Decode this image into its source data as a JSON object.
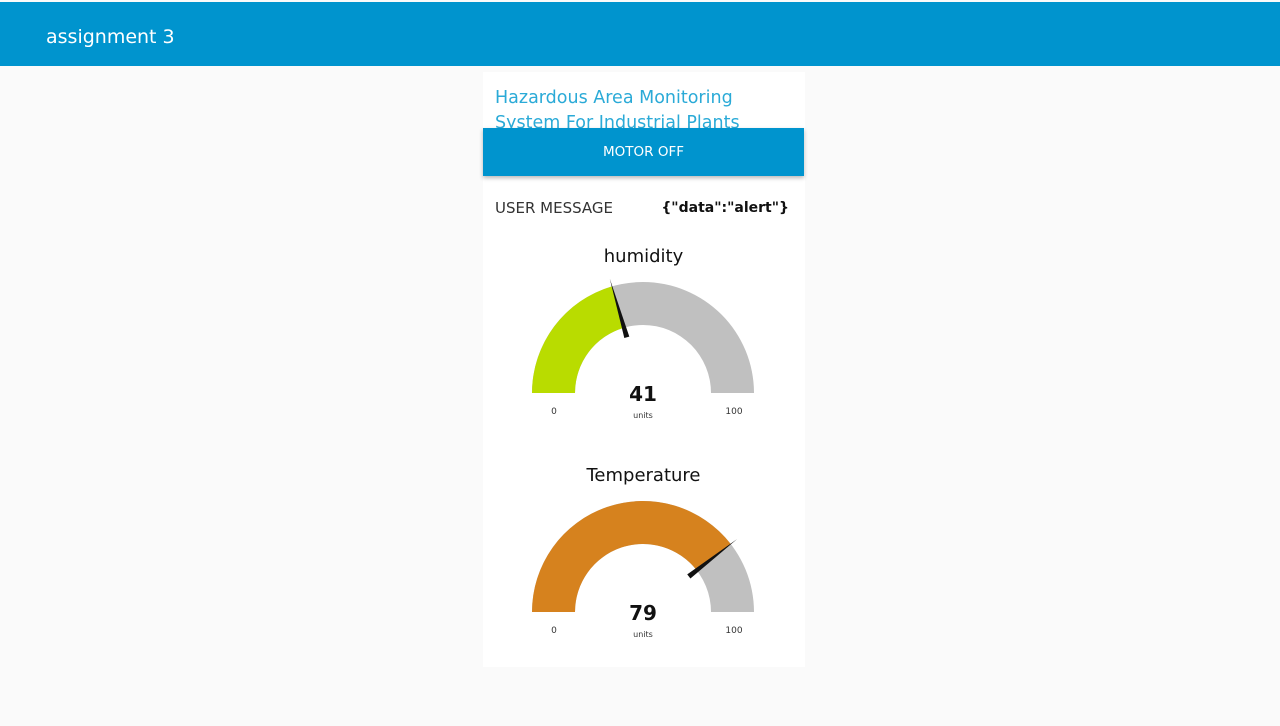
{
  "header": {
    "title": "assignment 3"
  },
  "panel": {
    "title": "Hazardous Area Monitoring System For Industrial Plants",
    "motor_button_label": "MOTOR OFF",
    "user_message": {
      "label": "USER MESSAGE",
      "value": "{\"data\":\"alert\"}"
    }
  },
  "gauges": [
    {
      "title": "humidity",
      "value": 41,
      "value_text": "41",
      "units": "units",
      "min": 0,
      "max": 100,
      "min_label": "0",
      "max_label": "100",
      "color": "#b9dc00"
    },
    {
      "title": "Temperature",
      "value": 79,
      "value_text": "79",
      "units": "units",
      "min": 0,
      "max": 100,
      "min_label": "0",
      "max_label": "100",
      "color": "#d6821e"
    }
  ],
  "colors": {
    "header_bg": "#0094ce",
    "title_text": "#2aaad7",
    "gauge_track": "#c0c0c0",
    "page_bg": "#fafafa"
  }
}
